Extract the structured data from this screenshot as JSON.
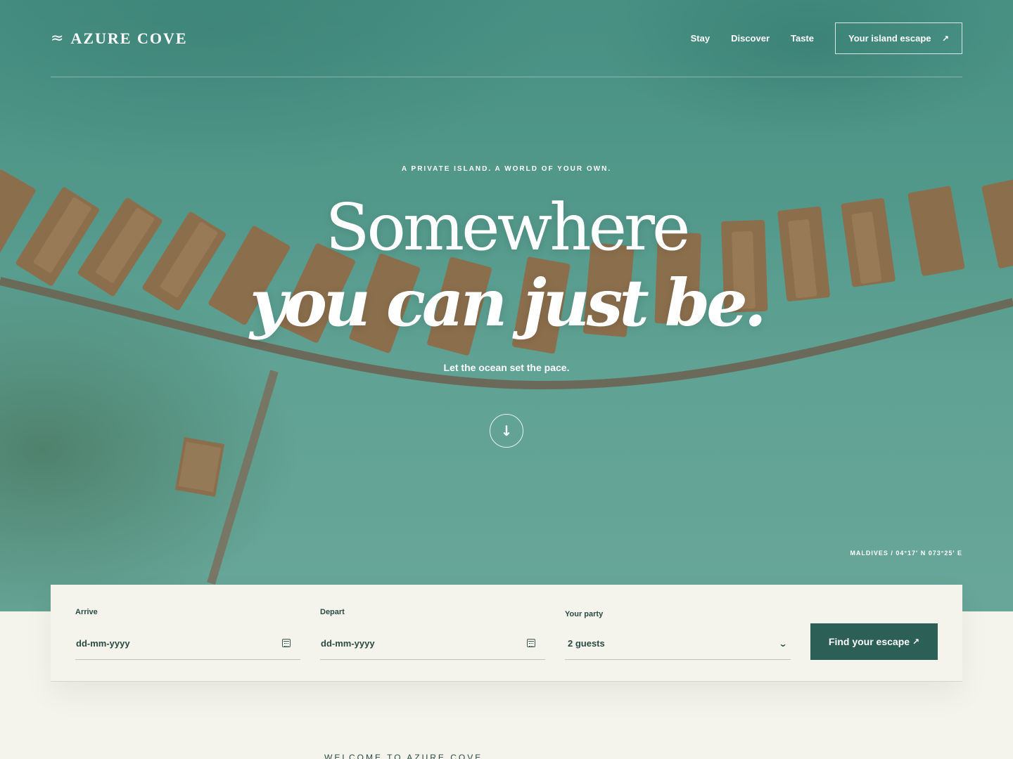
{
  "brand": {
    "icon": "wave-icon",
    "icon_glyph": "≈",
    "name": "AZURE COVE"
  },
  "nav": {
    "links": [
      "Stay",
      "Discover",
      "Taste"
    ],
    "cta_label": "Your island escape",
    "cta_icon": "↗"
  },
  "hero": {
    "eyebrow": "A PRIVATE ISLAND. A WORLD OF YOUR OWN.",
    "headline_line1": "Somewhere",
    "headline_line2": "you can just be.",
    "tagline": "Let the ocean set the pace.",
    "scroll_icon": "↓",
    "location": "MALDIVES / 04°17′ N 073°25′ E"
  },
  "booking": {
    "arrive_label": "Arrive",
    "arrive_placeholder": "dd-mm-yyyy",
    "depart_label": "Depart",
    "depart_placeholder": "dd-mm-yyyy",
    "party_label": "Your party",
    "party_value": "2 guests",
    "submit_label": "Find your escape",
    "submit_icon": "↗"
  },
  "intro": {
    "eyebrow": "WELCOME TO AZURE COVE"
  },
  "colors": {
    "accent": "#2c5f55",
    "sea": "#5da797",
    "sand": "#f4f3ec",
    "roof": "#a07a55"
  }
}
